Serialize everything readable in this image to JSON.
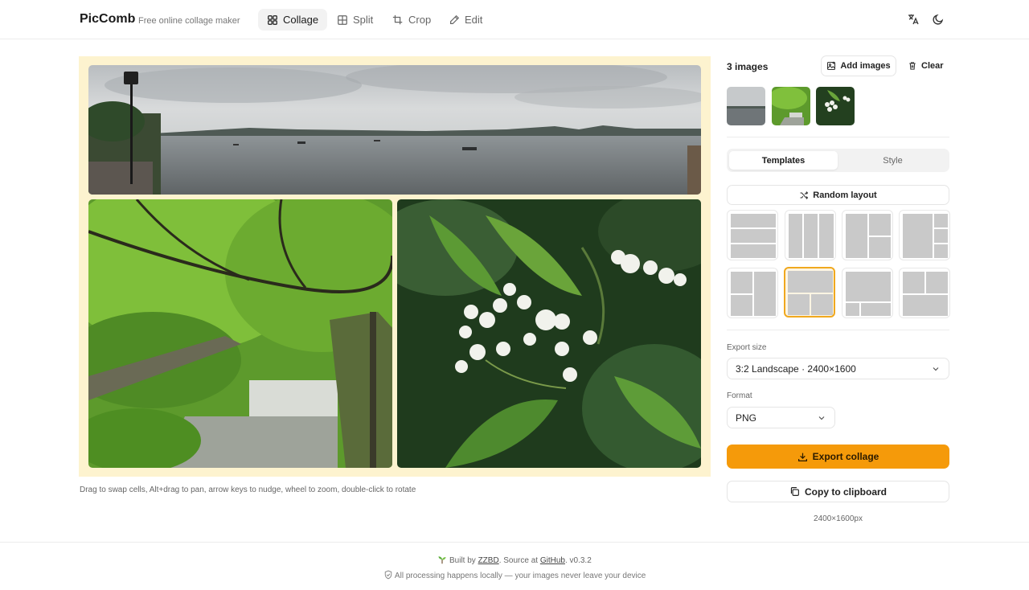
{
  "header": {
    "logo": "PicComb",
    "tagline": "Free online collage maker",
    "tabs": [
      {
        "label": "Collage",
        "icon": "grid-icon",
        "active": true
      },
      {
        "label": "Split",
        "icon": "split-icon",
        "active": false
      },
      {
        "label": "Crop",
        "icon": "crop-icon",
        "active": false
      },
      {
        "label": "Edit",
        "icon": "pencil-icon",
        "active": false
      }
    ],
    "right_icons": [
      "translate-icon",
      "moon-icon"
    ]
  },
  "canvas": {
    "background": "#fdf3cf",
    "cells": [
      {
        "name": "lake-panorama-photo"
      },
      {
        "name": "forest-waterfall-photo"
      },
      {
        "name": "white-blossom-photo"
      }
    ]
  },
  "hint": "Drag to swap cells, Alt+drag to pan, arrow keys to nudge, wheel to zoom, double-click to rotate",
  "sidebar": {
    "image_count": "3 images",
    "add_images": "Add images",
    "clear": "Clear",
    "thumbnails": [
      "lake-thumbnail",
      "waterfall-thumbnail",
      "blossom-thumbnail"
    ],
    "tabs": {
      "templates": "Templates",
      "style": "Style"
    },
    "random_layout": "Random layout",
    "templates_selected_index": 5,
    "export_size_label": "Export size",
    "export_size_value": "3:2 Landscape · 2400×1600",
    "format_label": "Format",
    "format_value": "PNG",
    "export_button": "Export collage",
    "copy_button": "Copy to clipboard",
    "dimensions": "2400×1600px"
  },
  "footer": {
    "built_by_prefix": "Built by ",
    "author": "ZZBD",
    "source_prefix": ". Source at ",
    "source": "GitHub",
    "version": ". v0.3.2",
    "privacy": "All processing happens locally — your images never leave your device"
  },
  "colors": {
    "accent": "#f59a0a",
    "selected_border": "#f0a81e"
  }
}
